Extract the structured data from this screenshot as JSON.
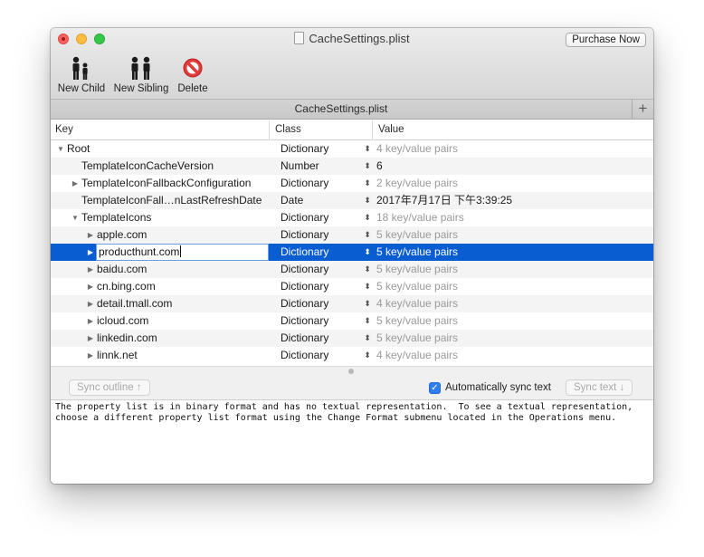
{
  "window": {
    "title": "CacheSettings.plist",
    "purchase_button": "Purchase Now"
  },
  "toolbar": {
    "new_child": "New Child",
    "new_sibling": "New Sibling",
    "delete": "Delete"
  },
  "document_tab": {
    "label": "CacheSettings.plist",
    "add": "+"
  },
  "columns": {
    "key": "Key",
    "class": "Class",
    "value": "Value"
  },
  "rows": [
    {
      "key": "Root",
      "class": "Dictionary",
      "value": "4 key/value pairs"
    },
    {
      "key": "TemplateIconCacheVersion",
      "class": "Number",
      "value": "6"
    },
    {
      "key": "TemplateIconFallbackConfiguration",
      "class": "Dictionary",
      "value": "2 key/value pairs"
    },
    {
      "key": "TemplateIconFall…nLastRefreshDate",
      "class": "Date",
      "value": "2017年7月17日 下午3:39:25"
    },
    {
      "key": "TemplateIcons",
      "class": "Dictionary",
      "value": "18 key/value pairs"
    },
    {
      "key": "apple.com",
      "class": "Dictionary",
      "value": "5 key/value pairs"
    },
    {
      "key": "producthunt.com",
      "class": "Dictionary",
      "value": "5 key/value pairs"
    },
    {
      "key": "baidu.com",
      "class": "Dictionary",
      "value": "5 key/value pairs"
    },
    {
      "key": "cn.bing.com",
      "class": "Dictionary",
      "value": "5 key/value pairs"
    },
    {
      "key": "detail.tmall.com",
      "class": "Dictionary",
      "value": "4 key/value pairs"
    },
    {
      "key": "icloud.com",
      "class": "Dictionary",
      "value": "5 key/value pairs"
    },
    {
      "key": "linkedin.com",
      "class": "Dictionary",
      "value": "5 key/value pairs"
    },
    {
      "key": "linnk.net",
      "class": "Dictionary",
      "value": "4 key/value pairs"
    }
  ],
  "sync": {
    "sync_outline": "Sync outline ↑",
    "auto_sync_label": "Automatically sync text",
    "auto_sync_checked": true,
    "sync_text": "Sync text ↓"
  },
  "text_view": {
    "line1": "The property list is in binary format and has no textual representation.  To see a textual representation,",
    "line2": "choose a different property list format using the Change Format submenu located in the Operations menu."
  }
}
